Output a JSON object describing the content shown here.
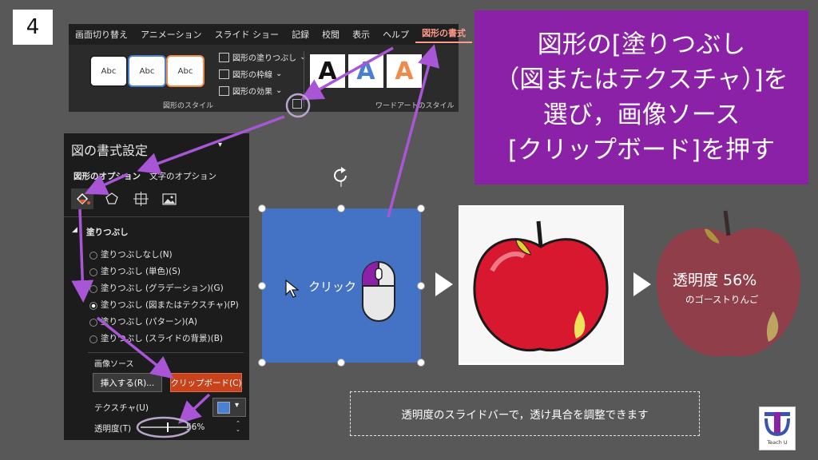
{
  "step_number": "4",
  "ribbon": {
    "tabs": [
      "画面切り替え",
      "アニメーション",
      "スライド ショー",
      "記録",
      "校閲",
      "表示",
      "ヘルプ",
      "図形の書式"
    ],
    "active_tab": "図形の書式",
    "style_swatches": [
      "Abc",
      "Abc",
      "Abc"
    ],
    "fill_label": "図形の塗りつぶし",
    "outline_label": "図形の枠線",
    "effect_label": "図形の効果",
    "shape_styles_group": "図形のスタイル",
    "wordart_group": "ワードアートのスタイル",
    "wordart_letters": [
      "A",
      "A",
      "A"
    ],
    "wordart_colors": [
      "#111111",
      "#4a7fd6",
      "#f08a4b"
    ]
  },
  "title_lines": [
    "図形の[塗りつぶし",
    "（図またはテクスチャ）]を",
    "選び，画像ソース",
    "[クリップボード]を押す"
  ],
  "pane": {
    "title": "図の書式設定",
    "tab_shape_options": "図形のオプション",
    "tab_text_options": "文字のオプション",
    "section_fill": "塗りつぶし",
    "fill_options": [
      "塗りつぶしなし(N)",
      "塗りつぶし (単色)(S)",
      "塗りつぶし (グラデーション)(G)",
      "塗りつぶし (図またはテクスチャ)(P)",
      "塗りつぶし (パターン)(A)",
      "塗りつぶし (スライドの背景)(B)"
    ],
    "selected_index": 3,
    "image_source_label": "画像ソース",
    "insert_button": "挿入する(R)...",
    "clipboard_button": "クリップボード(C)",
    "texture_label": "テクスチャ(U)",
    "transparency_label": "透明度(T)",
    "transparency_value": "56%",
    "transparency_level": 0.56
  },
  "canvas": {
    "click_label": "クリック",
    "ghost_text_line1": "透明度 56%",
    "ghost_text_line2": "のゴーストりんご"
  },
  "info_text": "透明度のスライドバーで，透け具合を調整できます",
  "logo_text": "Teach U",
  "colors": {
    "background": "#585858",
    "accent_purple": "#8b21a6",
    "arrow_purple": "#a855d6",
    "clipboard_button": "#c8421c",
    "shape_blue": "#4472c4"
  }
}
